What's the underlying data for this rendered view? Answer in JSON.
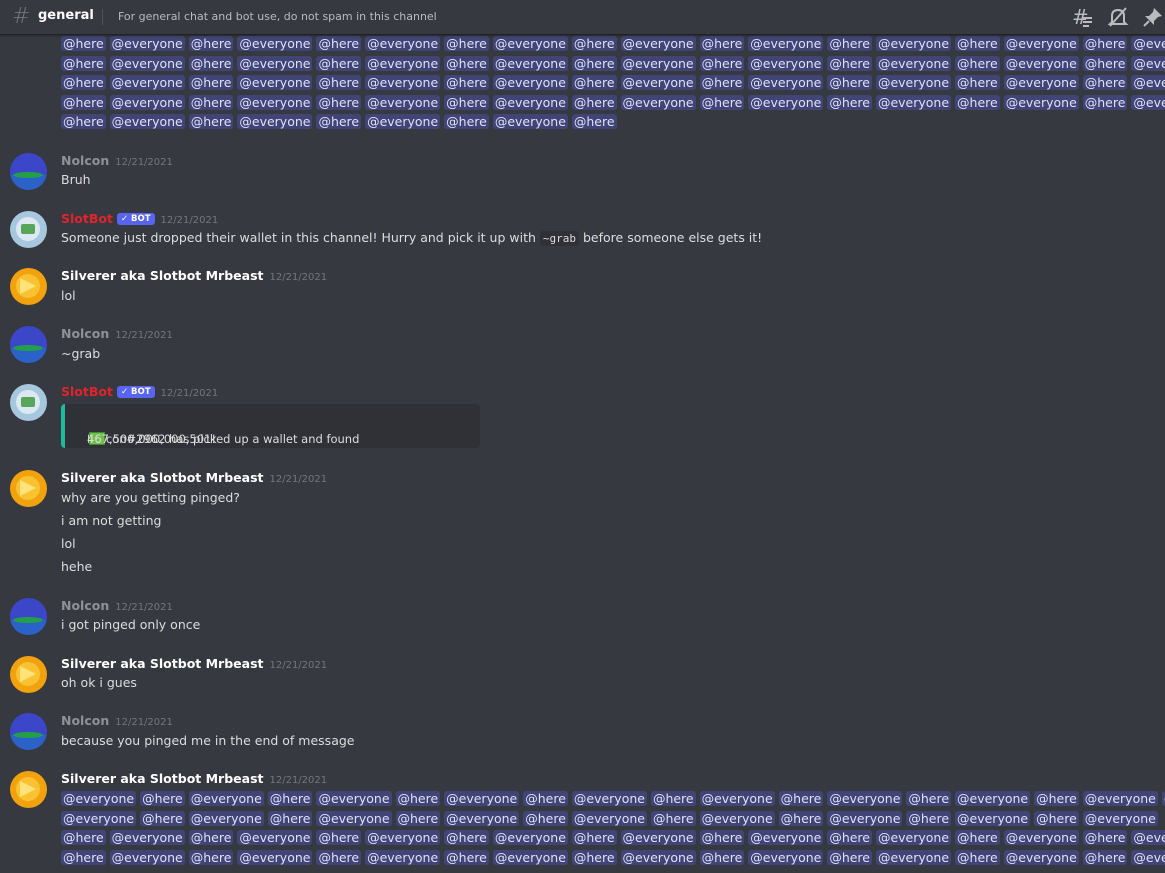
{
  "header": {
    "channel_name": "general",
    "topic": "For general chat and bot use, do not spam in this channel",
    "icons": [
      "threads-icon",
      "mute-bell-icon",
      "pin-icon"
    ]
  },
  "top_spam_lines": [
    [
      "@here",
      "@everyone",
      "@here",
      "@everyone",
      "@here",
      "@everyone",
      "@here",
      "@everyone",
      "@here",
      "@everyone",
      "@here",
      "@everyone",
      "@here",
      "@everyone",
      "@here",
      "@everyone",
      "@here",
      "@everyone"
    ],
    [
      "@here",
      "@everyone",
      "@here",
      "@everyone",
      "@here",
      "@everyone",
      "@here",
      "@everyone",
      "@here",
      "@everyone",
      "@here",
      "@everyone",
      "@here",
      "@everyone",
      "@here",
      "@everyone",
      "@here",
      "@everyone"
    ],
    [
      "@here",
      "@everyone",
      "@here",
      "@everyone",
      "@here",
      "@everyone",
      "@here",
      "@everyone",
      "@here",
      "@everyone",
      "@here",
      "@everyone",
      "@here",
      "@everyone",
      "@here",
      "@everyone",
      "@here",
      "@everyone"
    ],
    [
      "@here",
      "@everyone",
      "@here",
      "@everyone",
      "@here",
      "@everyone",
      "@here",
      "@everyone",
      "@here",
      "@everyone",
      "@here",
      "@everyone",
      "@here",
      "@everyone",
      "@here",
      "@everyone",
      "@here",
      "@everyone"
    ],
    [
      "@here",
      "@everyone",
      "@here",
      "@everyone",
      "@here",
      "@everyone",
      "@here",
      "@everyone",
      "@here"
    ]
  ],
  "messages": [
    {
      "author": "Nolcon",
      "timestamp": "12/21/2021",
      "lines": [
        "Bruh"
      ]
    },
    {
      "author": "SlotBot",
      "badge": "✓ BOT",
      "timestamp": "12/21/2021",
      "text_before": "Someone just dropped their wallet in this channel! Hurry and pick it up with ",
      "code": "~grab",
      "text_after": " before someone else gets it!"
    },
    {
      "author": "Silverer aka Slotbot Mrbeast",
      "timestamp": "12/21/2021",
      "lines": [
        "lol"
      ]
    },
    {
      "author": "Nolcon",
      "timestamp": "12/21/2021",
      "lines": [
        "~grab"
      ]
    },
    {
      "author": "SlotBot",
      "badge": "✓ BOT",
      "timestamp": "12/21/2021",
      "embed_before": "Nolcon#2962 has picked up a wallet and found",
      "embed_amount": "467,500,000,000,501!"
    },
    {
      "author": "Silverer aka Slotbot Mrbeast",
      "timestamp": "12/21/2021",
      "lines": [
        "why are you getting pinged?",
        "i am not getting",
        "lol",
        "hehe"
      ]
    },
    {
      "author": "Nolcon",
      "timestamp": "12/21/2021",
      "lines": [
        "i got pinged only once"
      ]
    },
    {
      "author": "Silverer aka Slotbot Mrbeast",
      "timestamp": "12/21/2021",
      "lines": [
        "oh ok i gues"
      ]
    },
    {
      "author": "Nolcon",
      "timestamp": "12/21/2021",
      "lines": [
        "because you pinged me in the end of message"
      ]
    },
    {
      "author": "Silverer aka Slotbot Mrbeast",
      "timestamp": "12/21/2021",
      "lines": []
    }
  ],
  "bottom_spam_lines": [
    [
      "@everyone",
      "@here",
      "@everyone",
      "@here",
      "@everyone",
      "@here",
      "@everyone",
      "@here",
      "@everyone",
      "@here",
      "@everyone",
      "@here",
      "@everyone",
      "@here",
      "@everyone",
      "@here",
      "@everyone",
      "@here"
    ],
    [
      "@everyone",
      "@here",
      "@everyone",
      "@here",
      "@everyone",
      "@here",
      "@everyone",
      "@here",
      "@everyone",
      "@here",
      "@everyone",
      "@here",
      "@everyone",
      "@here",
      "@everyone",
      "@here",
      "@everyone"
    ],
    [
      "@here",
      "@everyone",
      "@here",
      "@everyone",
      "@here",
      "@everyone",
      "@here",
      "@everyone",
      "@here",
      "@everyone",
      "@here",
      "@everyone",
      "@here",
      "@everyone",
      "@here",
      "@everyone",
      "@here",
      "@everyone"
    ],
    [
      "@here",
      "@everyone",
      "@here",
      "@everyone",
      "@here",
      "@everyone",
      "@here",
      "@everyone",
      "@here",
      "@everyone",
      "@here",
      "@everyone",
      "@here",
      "@everyone",
      "@here",
      "@everyone",
      "@here",
      "@everyone"
    ]
  ],
  "colors": {
    "bot_name": "#e0242c",
    "mention_bg": "#4a4f8c",
    "embed_accent": "#1abc9c",
    "user_name": "#ffffff",
    "nolcon_name": "#8e9297"
  }
}
